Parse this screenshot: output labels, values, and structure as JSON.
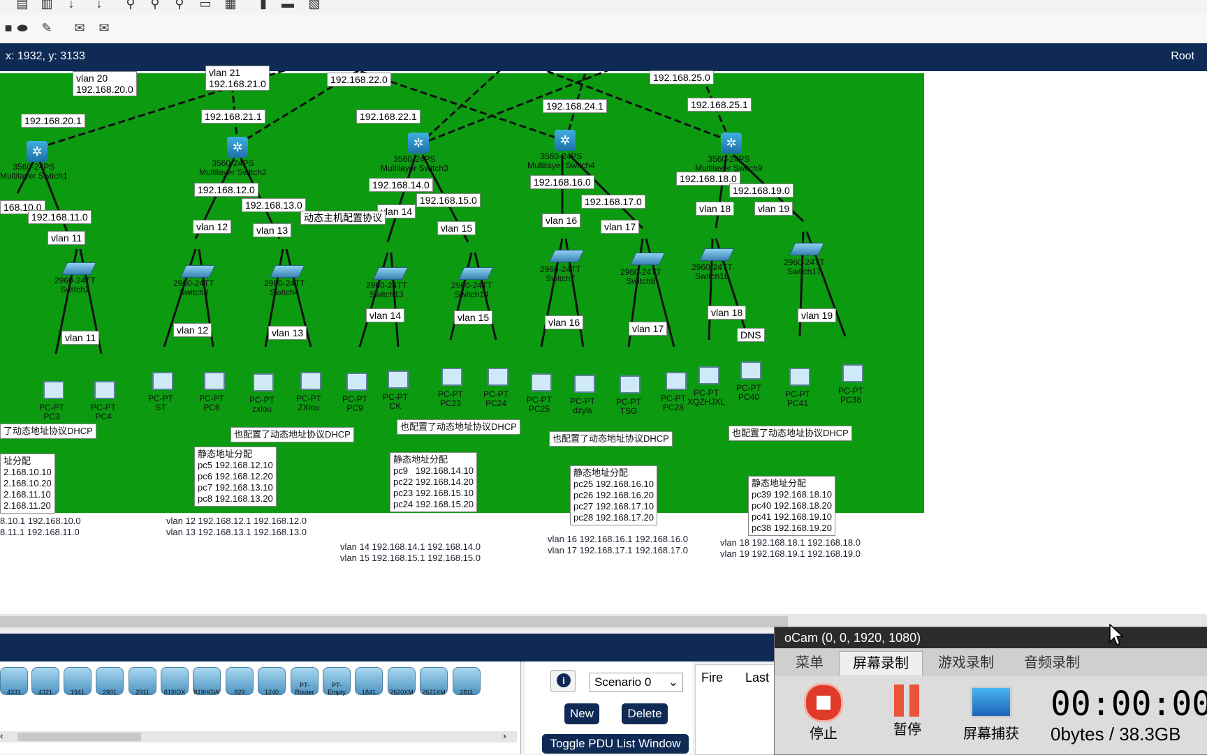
{
  "status_bar": {
    "coords": "x: 1932, y: 3133",
    "root": "Root"
  },
  "subnets": [
    {
      "text": "vlan 20\n192.168.20.0"
    },
    {
      "text": "vlan 21\n192.168.21.0"
    },
    {
      "text": "192.168.22.0"
    },
    {
      "text": "192.168.25.0"
    },
    {
      "text": "192.168.20.1"
    },
    {
      "text": "192.168.21.1"
    },
    {
      "text": "192.168.22.1"
    },
    {
      "text": "192.168.24.1"
    },
    {
      "text": "192.168.25.1"
    }
  ],
  "ml_switches": [
    {
      "model": "3560-24PS",
      "name": "Multilayer Switch1"
    },
    {
      "model": "3560-24PS",
      "name": "Multilayer Switch2"
    },
    {
      "model": "3560-24PS",
      "name": "Multilayer Switch3"
    },
    {
      "model": "3560-24PS",
      "name": "Multilayer Switch4"
    },
    {
      "model": "3560-24PS",
      "name": "Multilayer Switch9"
    }
  ],
  "ip_labels": [
    "168.10.0",
    "192.168.11.0",
    "192.168.12.0",
    "192.168.13.0",
    "192.168.14.0",
    "192.168.15.0",
    "192.168.16.0",
    "192.168.17.0",
    "192.168.18.0",
    "192.168.19.0"
  ],
  "vlan_labels_top": [
    "vlan 11",
    "vlan 12",
    "vlan 13",
    "vlan 14",
    "vlan 15",
    "vlan 16",
    "vlan 17",
    "vlan 18",
    "vlan 19"
  ],
  "annot_dhcp_host": "动态主机配置协议",
  "switches": [
    {
      "model": "2960-24TT",
      "name": "Switch2"
    },
    {
      "model": "2960-24TT",
      "name": "Switch3"
    },
    {
      "model": "2960-24TT",
      "name": "Switch4"
    },
    {
      "model": "2960-24TT",
      "name": "Switch13"
    },
    {
      "model": "2960-24TT",
      "name": "Switch14"
    },
    {
      "model": "2960-24TT",
      "name": "Switch7"
    },
    {
      "model": "2960-24TT",
      "name": "Switch8"
    },
    {
      "model": "2960-24TT",
      "name": "Switch16"
    },
    {
      "model": "2960-24TT",
      "name": "Switch17"
    }
  ],
  "vlan_labels_bottom": [
    "vlan 11",
    "vlan 12",
    "vlan 13",
    "vlan 14",
    "vlan 15",
    "vlan 16",
    "vlan 17",
    "vlan 18",
    "DNS",
    "vlan 19"
  ],
  "pcs": [
    {
      "t": "PC-PT",
      "n": "PC3"
    },
    {
      "t": "PC-PT",
      "n": "PC4"
    },
    {
      "t": "PC-PT",
      "n": "ST"
    },
    {
      "t": "PC-PT",
      "n": "PC6"
    },
    {
      "t": "PC-PT",
      "n": "zxlou"
    },
    {
      "t": "PC-PT",
      "n": "ZXlou"
    },
    {
      "t": "PC-PT",
      "n": "PC9"
    },
    {
      "t": "PC-PT",
      "n": "CK"
    },
    {
      "t": "PC-PT",
      "n": "PC23"
    },
    {
      "t": "PC-PT",
      "n": "PC24"
    },
    {
      "t": "PC-PT",
      "n": "PC25"
    },
    {
      "t": "PC-PT",
      "n": "dzyls"
    },
    {
      "t": "PC-PT",
      "n": "TSG"
    },
    {
      "t": "PC-PT",
      "n": "PC28"
    },
    {
      "t": "PC-PT",
      "n": "XQZHJXL"
    },
    {
      "t": "PC-PT",
      "n": "PC40"
    },
    {
      "t": "PC-PT",
      "n": "PC41"
    },
    {
      "t": "PC-PT",
      "n": "PC38"
    }
  ],
  "dhcp_notes": [
    "了动态地址协议DHCP",
    "也配置了动态地址协议DHCP",
    "也配置了动态地址协议DHCP",
    "也配置了动态地址协议DHCP",
    "也配置了动态地址协议DHCP"
  ],
  "static_notes": [
    "址分配\n2.168.10.10\n2.168.10.20\n2.168.11.10\n2.168.11.20",
    "静态地址分配\npc5 192.168.12.10\npc6 192.168.12.20\npc7 192.168.13.10\npc8 192.168.13.20",
    "静态地址分配\npc9   192.168.14.10\npc22 192.168.14.20\npc23 192.168.15.10\npc24 192.168.15.20",
    "静态地址分配\npc25 192.168.16.10\npc26 192.168.16.20\npc27 192.168.17.10\npc28 192.168.17.20",
    "静态地址分配\npc39 192.168.18.10\npc40 192.168.18.20\npc41 192.168.19.10\npc38 192.168.19.20"
  ],
  "vlan_summaries": [
    "8.10.1 192.168.10.0\n8.11.1 192.168.11.0",
    "vlan 12 192.168.12.1 192.168.12.0\nvlan 13 192.168.13.1 192.168.13.0",
    "vlan 14 192.168.14.1 192.168.14.0\nvlan 15 192.168.15.1 192.168.15.0",
    "vlan 16 192.168.16.1 192.168.16.0\nvlan 17 192.168.17.1 192.168.17.0",
    "vlan 18 192.168.18.1 192.168.18.0\nvlan 19 192.168.19.1 192.168.19.0"
  ],
  "device_list": [
    "4331",
    "4321",
    "1941",
    "2901",
    "2911",
    "819IOX",
    "819HGW",
    "829",
    "1240",
    "PT-Router",
    "PT-Empty",
    "1841",
    "2620XM",
    "2621XM",
    "2811"
  ],
  "pdu": {
    "scenario": "Scenario 0",
    "new": "New",
    "delete": "Delete",
    "toggle": "Toggle PDU List Window",
    "info": "i"
  },
  "fire_cols": [
    "Fire",
    "Last"
  ],
  "ocam": {
    "title": "oCam (0, 0, 1920, 1080)",
    "tabs": [
      "菜单",
      "屏幕录制",
      "游戏录制",
      "音频录制"
    ],
    "buttons": [
      "停止",
      "暂停",
      "屏幕捕获"
    ],
    "timer": "00:00:00",
    "size": "0bytes / 38.3GB"
  },
  "colors": {
    "workspace": "#0b9a10",
    "bar": "#0e2a55",
    "link": "#111111"
  }
}
